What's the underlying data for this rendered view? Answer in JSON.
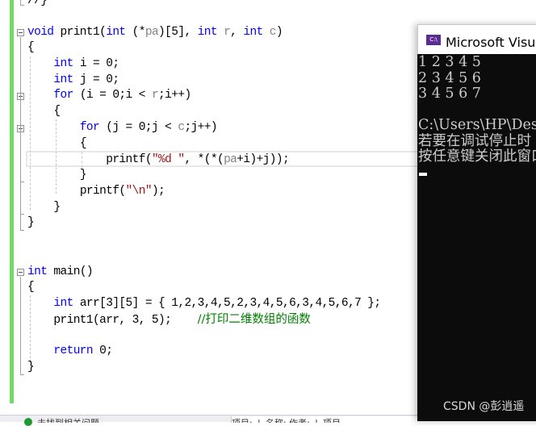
{
  "editor": {
    "lines": [
      {
        "text": "//}"
      },
      {
        "text": ""
      },
      {
        "kw": "void",
        "rest": " print1(int (*pa)[5], int r, int c)"
      },
      {
        "text": "{"
      },
      {
        "text": "    int i = 0;"
      },
      {
        "text": "    int j = 0;"
      },
      {
        "text": "    for (i = 0;i < r;i++)"
      },
      {
        "text": "    {"
      },
      {
        "text": "        for (j = 0;j < c;j++)"
      },
      {
        "text": "        {"
      },
      {
        "text": "            printf(\"%d \", *(*(pa+i)+j));"
      },
      {
        "text": "        }"
      },
      {
        "text": "        printf(\"\\n\");"
      },
      {
        "text": "    }"
      },
      {
        "text": "}"
      },
      {
        "text": ""
      },
      {
        "text": ""
      },
      {
        "text": "int main()"
      },
      {
        "text": "{"
      },
      {
        "text": "    int arr[3][5] = { 1,2,3,4,5,2,3,4,5,6,3,4,5,6,7 };"
      },
      {
        "text": "    print1(arr, 3, 5);    //打印二维数组的函数"
      },
      {
        "text": ""
      },
      {
        "text": "    return 0;"
      },
      {
        "text": "}"
      }
    ],
    "tokens": {
      "l0": "//}",
      "l2_kw": "void",
      "l2_fn": " print1(",
      "l2_int1": "int",
      "l2_a": " (*",
      "l2_pa": "pa",
      "l2_b": ")[5], ",
      "l2_int2": "int",
      "l2_r": " r",
      "l2_c1": ", ",
      "l2_int3": "int",
      "l2_c": " c",
      "l2_end": ")",
      "brace_open": "{",
      "brace_close": "}",
      "int": "int",
      "i_decl": " i = 0;",
      "j_decl": " j = 0;",
      "for": "for",
      "for_i_a": " (i = 0;i < ",
      "r": "r",
      "for_i_b": ";i++)",
      "for_j_a": " (j = 0;j < ",
      "c": "c",
      "for_j_b": ";j++)",
      "printf": "printf(",
      "fmt": "\"%d \"",
      "pf_a": ", *(*(",
      "pa": "pa",
      "pf_b": "+i)+j));",
      "nl": "\"\\n\"",
      "close_semi": ");",
      "main_rest": " main()",
      "arr_decl": " arr[3][5] = { 1,2,3,4,5,2,3,4,5,6,3,4,5,6,7 };",
      "call": "print1(arr, 3, 5);    ",
      "comment": "//打印二维数组的函数",
      "return": "return",
      "ret_rest": " 0;"
    }
  },
  "console": {
    "title": "Microsoft Visual Studio 调试控制台",
    "icon": "C:\\",
    "output": [
      "1 2 3 4 5",
      "2 3 4 5 6",
      "3 4 5 6 7",
      "",
      "C:\\Users\\HP\\Desktop",
      "若要在调试停止时",
      "按任意键关闭此窗口"
    ],
    "watermark": "CSDN @彭逍遥"
  },
  "bottom": {
    "status": "未找到相关问题",
    "tab": "项目: ↓ 名称: 作者: ↓ 项目"
  }
}
